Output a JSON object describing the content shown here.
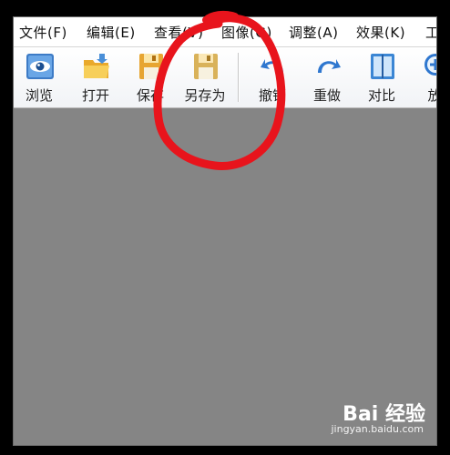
{
  "menu": {
    "items": [
      {
        "label": "文件(F)"
      },
      {
        "label": "编辑(E)"
      },
      {
        "label": "查看(V)"
      },
      {
        "label": "图像(G)"
      },
      {
        "label": "调整(A)"
      },
      {
        "label": "效果(K)"
      },
      {
        "label": "工"
      }
    ]
  },
  "toolbar": {
    "browse": {
      "label": "浏览",
      "icon": "eye-icon"
    },
    "open": {
      "label": "打开",
      "icon": "folder-open-icon"
    },
    "save": {
      "label": "保存",
      "icon": "floppy-disk-icon"
    },
    "save_as": {
      "label": "另存为",
      "icon": "floppy-disk-icon"
    },
    "undo": {
      "label": "撤销",
      "icon": "undo-arrow-icon"
    },
    "redo": {
      "label": "重做",
      "icon": "redo-arrow-icon"
    },
    "compare": {
      "label": "对比",
      "icon": "compare-icon"
    },
    "zoom": {
      "label": "放",
      "icon": "zoom-in-icon"
    }
  },
  "watermark": {
    "logo_text": "Bai 经验",
    "url": "jingyan.baidu.com"
  },
  "colors": {
    "canvas_background": "#858585",
    "annotation_red": "#e8141c"
  }
}
